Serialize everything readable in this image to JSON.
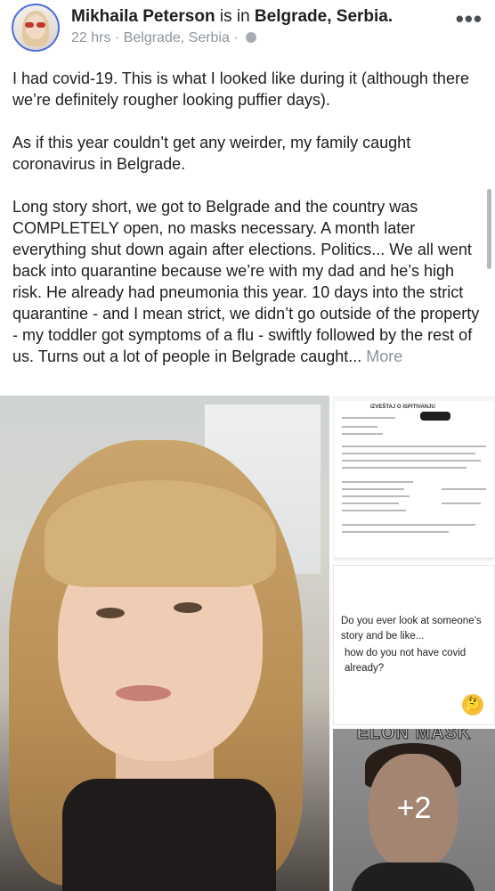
{
  "post": {
    "author": "Mikhaila Peterson",
    "is_in": "is in",
    "location": "Belgrade, Serbia.",
    "time": "22 hrs",
    "place": "Belgrade, Serbia",
    "sep": "·",
    "menu_icon": "more-dots-icon",
    "privacy_icon": "globe-icon",
    "paragraphs": [
      "I had covid-19. This is what I looked like during it (although there we’re definitely rougher looking puffier days).",
      "As if this year couldn’t get any weirder, my family caught coronavirus in Belgrade.",
      "Long story short, we got to Belgrade and the country was COMPLETELY open, no masks necessary. A month later everything shut down again after elections. Politics... We all went back into quarantine because we’re with my dad and he’s high risk. He already had pneumonia this year. 10 days into the strict quarantine - and I mean strict, we didn’t go outside of the property - my toddler got symptoms of a flu - swiftly followed by the rest of us. Turns out a lot of people in Belgrade caught..."
    ],
    "more_label": "More"
  },
  "media": {
    "doc_title": "IZVEŠTAJ O ISPITIVANJU",
    "quote_line1": "Do you ever look at someone’s story and be like...",
    "quote_line2": "how do you not have covid already?",
    "quote_emoji": "🤔",
    "meme_caption": "ELON MASK",
    "more_count": "+2"
  }
}
